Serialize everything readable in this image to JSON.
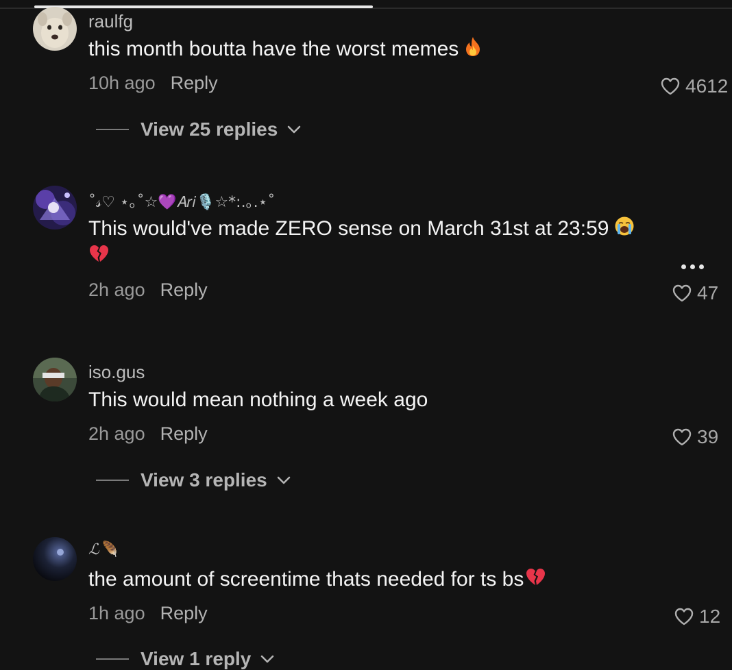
{
  "comments": [
    {
      "username": "raulfg",
      "text": "this month boutta have the worst memes",
      "text_emoji": "fire",
      "time": "10h ago",
      "reply_label": "Reply",
      "likes": "4612",
      "view_replies": "View 25 replies"
    },
    {
      "username": "˚𝓈♡ ⋆｡˚☆💜𝐴𝑟𝑖🎙️☆*:.｡.⋆˚",
      "text": "This would've made ZERO sense on March 31st at 23:59",
      "text_emoji": "loudly-crying-face",
      "text_line2_emoji": "broken-heart",
      "time": "2h ago",
      "reply_label": "Reply",
      "likes": "47"
    },
    {
      "username": "iso.gus",
      "text": "This would mean nothing a week ago",
      "time": "2h ago",
      "reply_label": "Reply",
      "likes": "39",
      "view_replies": "View 3 replies"
    },
    {
      "username": "ℒ🪶",
      "text": "the amount of screentime thats needed for ts bs",
      "text_emoji": "broken-heart",
      "time": "1h ago",
      "reply_label": "Reply",
      "likes": "12",
      "view_replies": "View 1 reply"
    }
  ],
  "icons": {
    "like": "heart-outline-icon",
    "expand": "chevron-down-icon",
    "more": "more-options-icon"
  },
  "colors": {
    "background": "#131313",
    "text": "#f4f4f4",
    "muted": "#9a9a9a"
  }
}
